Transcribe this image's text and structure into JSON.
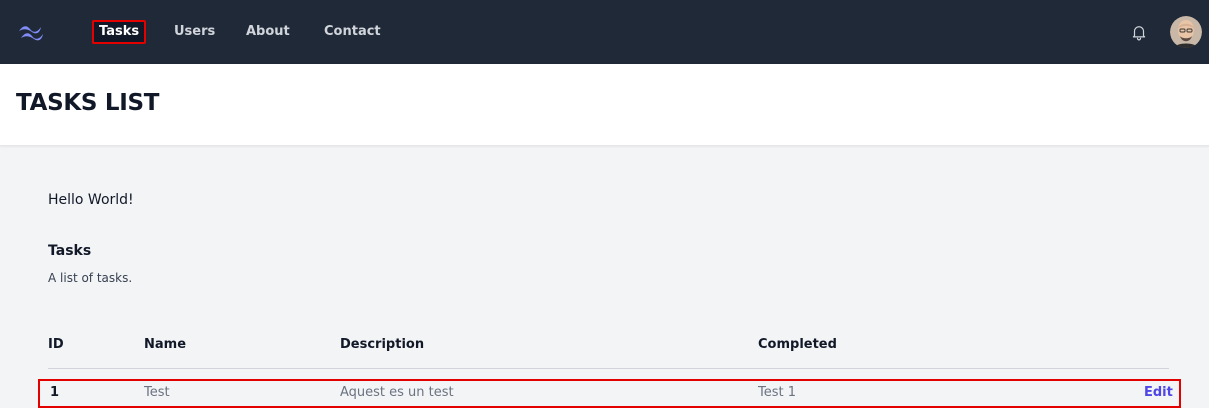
{
  "nav": {
    "links": [
      "Tasks",
      "Users",
      "About",
      "Contact"
    ],
    "active": "Tasks"
  },
  "colors": {
    "navbar": "#1f2937",
    "accent": "#4f46e5",
    "highlight": "#e50000",
    "logo": "#818cf8"
  },
  "header": {
    "title": "TASKS LIST"
  },
  "main": {
    "greeting": "Hello World!",
    "section_title": "Tasks",
    "section_subtitle": "A list of tasks."
  },
  "table": {
    "columns": [
      "ID",
      "Name",
      "Description",
      "Completed"
    ],
    "rows": [
      {
        "id": "1",
        "name": "Test",
        "description": "Aquest es un test",
        "completed": "Test 1",
        "action": "Edit"
      }
    ]
  },
  "icons": {
    "logo": "tailwind-logo-icon",
    "notifications": "bell-icon",
    "user": "avatar"
  }
}
